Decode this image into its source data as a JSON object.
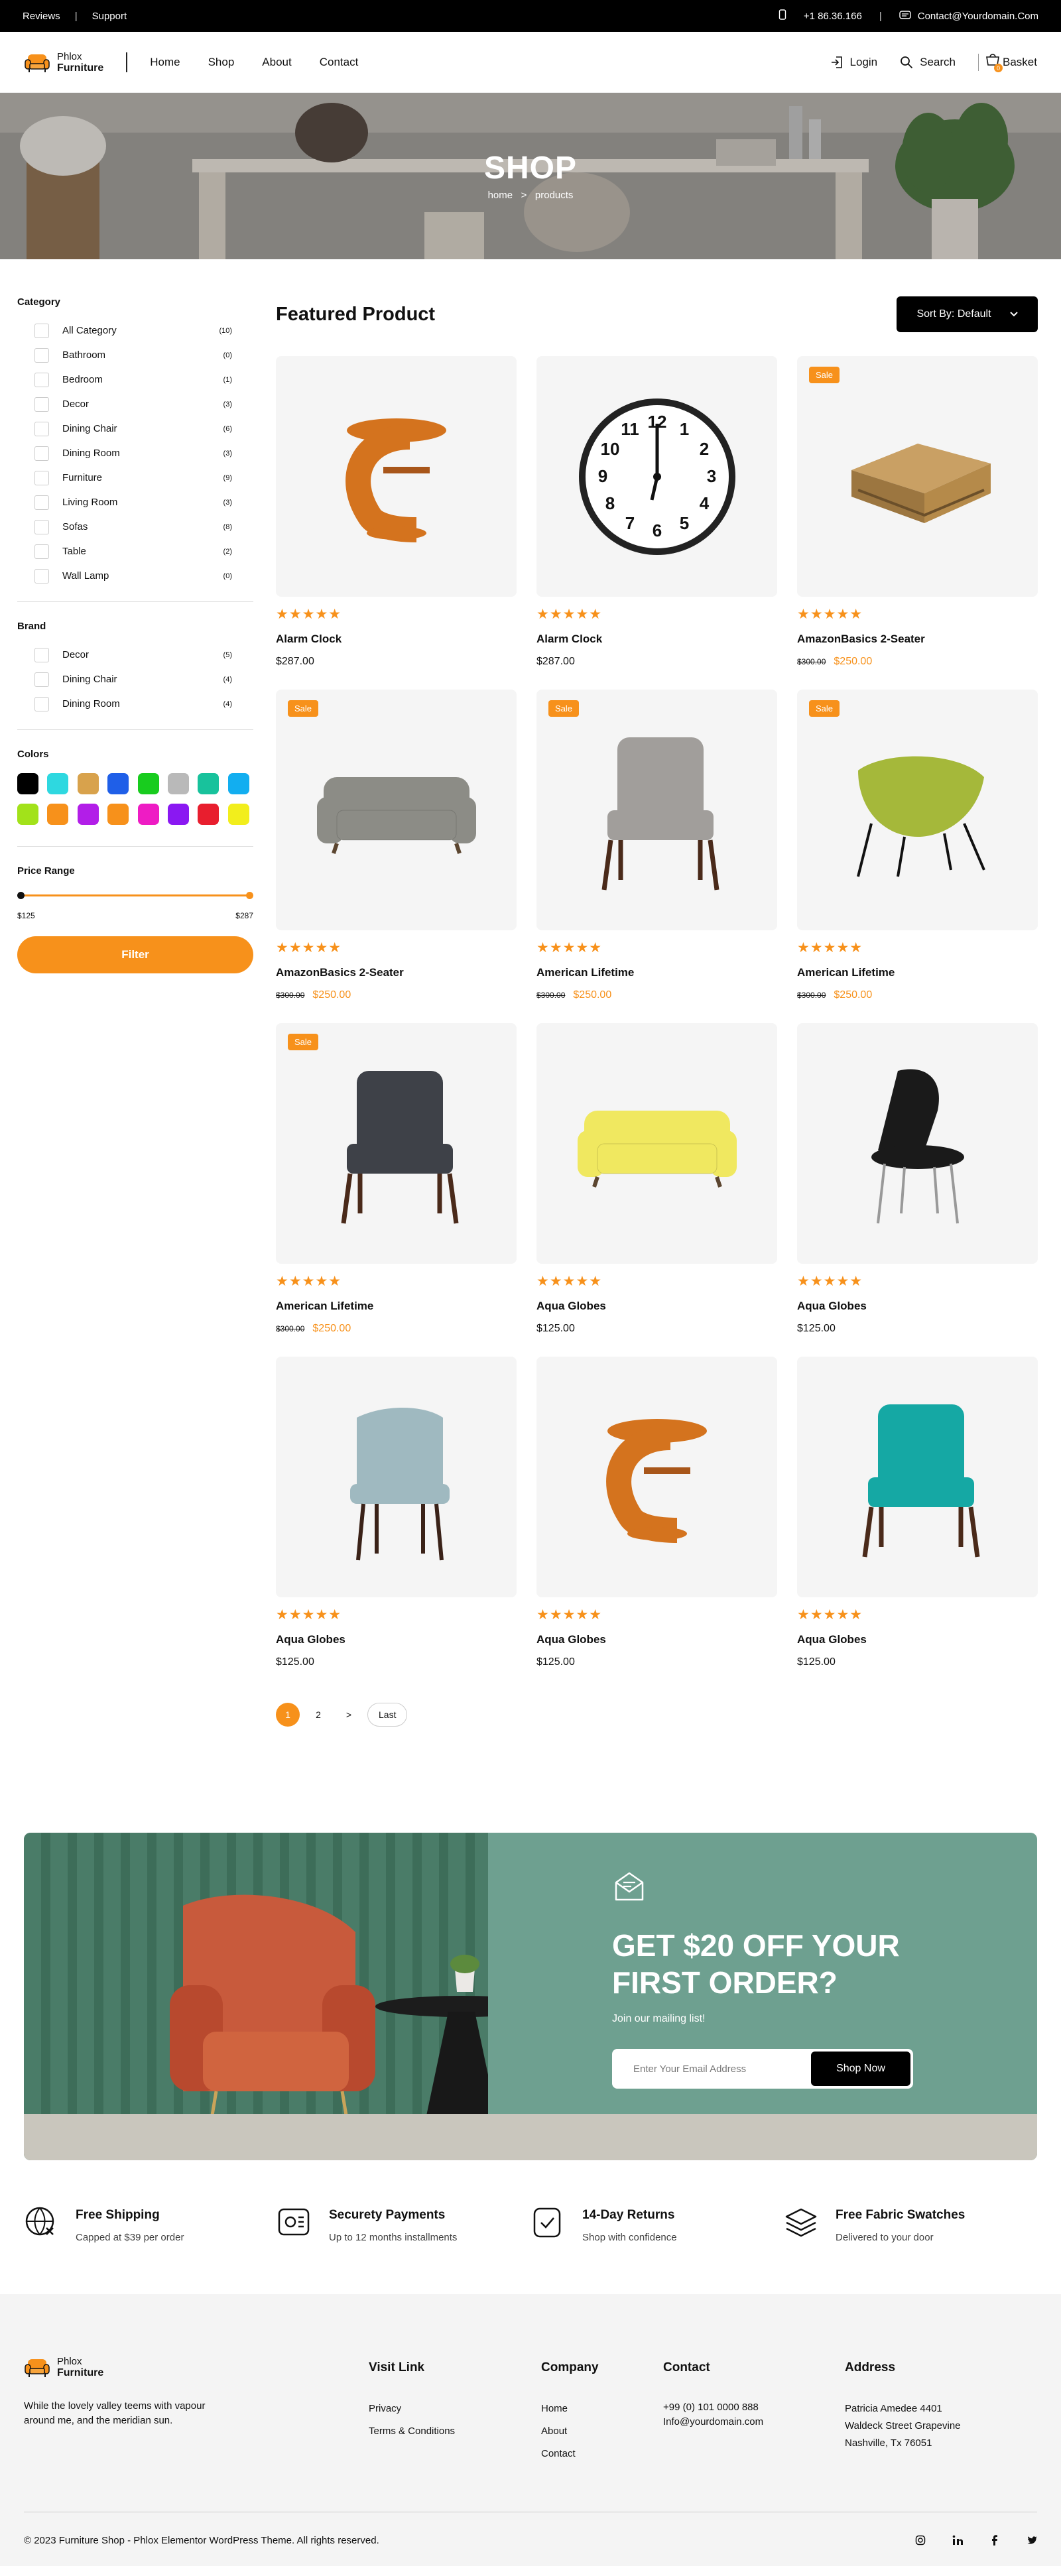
{
  "topbar": {
    "reviews": "Reviews",
    "support": "Support",
    "phone": "+1 86.36.166",
    "email": "Contact@Yourdomain.Com"
  },
  "brand": {
    "line1": "Phlox",
    "line2": "Furniture"
  },
  "nav": [
    "Home",
    "Shop",
    "About",
    "Contact"
  ],
  "header": {
    "login": "Login",
    "search": "Search",
    "basket": "Basket",
    "basket_count": "0"
  },
  "hero": {
    "title": "SHOP",
    "crumb_home": "home",
    "crumb_sep": ">",
    "crumb_current": "products"
  },
  "sidebar": {
    "category_title": "Category",
    "categories": [
      {
        "label": "All Category",
        "count": "(10)"
      },
      {
        "label": "Bathroom",
        "count": "(0)"
      },
      {
        "label": "Bedroom",
        "count": "(1)"
      },
      {
        "label": "Decor",
        "count": "(3)"
      },
      {
        "label": "Dining Chair",
        "count": "(6)"
      },
      {
        "label": "Dining Room",
        "count": "(3)"
      },
      {
        "label": "Furniture",
        "count": "(9)"
      },
      {
        "label": "Living Room",
        "count": "(3)"
      },
      {
        "label": "Sofas",
        "count": "(8)"
      },
      {
        "label": "Table",
        "count": "(2)"
      },
      {
        "label": "Wall Lamp",
        "count": "(0)"
      }
    ],
    "brand_title": "Brand",
    "brands": [
      {
        "label": "Decor",
        "count": "(5)"
      },
      {
        "label": "Dining Chair",
        "count": "(4)"
      },
      {
        "label": "Dining Room",
        "count": "(4)"
      }
    ],
    "colors_title": "Colors",
    "colors": [
      "#000000",
      "#2ed8e0",
      "#d8a24c",
      "#1f5fe8",
      "#18cc1e",
      "#b9b9b9",
      "#18c29c",
      "#12aef0",
      "#a2e21a",
      "#f7911b",
      "#b21ee8",
      "#f7911b",
      "#ee1cc4",
      "#8a18f2",
      "#e81e2e",
      "#f2ee1c"
    ],
    "price_title": "Price Range",
    "price_min": "$125",
    "price_max": "$287",
    "filter_label": "Filter"
  },
  "products_section": {
    "title": "Featured Product",
    "sort_label": "Sort By: Default"
  },
  "products": [
    {
      "name": "Alarm Clock",
      "stars": "★★★★★",
      "sale": "",
      "old_price": "",
      "price": "$287.00",
      "icon": "side-table-icon",
      "color": "#d4731e"
    },
    {
      "name": "Alarm Clock",
      "stars": "★★★★★",
      "sale": "",
      "old_price": "",
      "price": "$287.00",
      "icon": "wall-clock-icon",
      "color": "#111111"
    },
    {
      "name": "AmazonBasics 2-Seater",
      "stars": "★★★★★",
      "sale": "Sale",
      "old_price": "$300.00",
      "price": "$250.00",
      "icon": "pallet-table-icon",
      "color": "#b58a4a"
    },
    {
      "name": "AmazonBasics 2-Seater",
      "stars": "★★★★★",
      "sale": "Sale",
      "old_price": "$300.00",
      "price": "$250.00",
      "icon": "sofa-icon",
      "color": "#8c8c86"
    },
    {
      "name": "American Lifetime",
      "stars": "★★★★★",
      "sale": "Sale",
      "old_price": "$300.00",
      "price": "$250.00",
      "icon": "armchair-icon",
      "color": "#a19e9b"
    },
    {
      "name": "American Lifetime",
      "stars": "★★★★★",
      "sale": "Sale",
      "old_price": "$300.00",
      "price": "$250.00",
      "icon": "lounge-chair-icon",
      "color": "#a5b83a"
    },
    {
      "name": "American Lifetime",
      "stars": "★★★★★",
      "sale": "Sale",
      "old_price": "$300.00",
      "price": "$250.00",
      "icon": "armchair-icon",
      "color": "#3e4148"
    },
    {
      "name": "Aqua Globes",
      "stars": "★★★★★",
      "sale": "",
      "old_price": "",
      "price": "$125.00",
      "icon": "sofa-icon",
      "color": "#f0e860"
    },
    {
      "name": "Aqua Globes",
      "stars": "★★★★★",
      "sale": "",
      "old_price": "",
      "price": "$125.00",
      "icon": "chair-icon",
      "color": "#1a1a1a"
    },
    {
      "name": "Aqua Globes",
      "stars": "★★★★★",
      "sale": "",
      "old_price": "",
      "price": "$125.00",
      "icon": "dining-chair-icon",
      "color": "#9fb9c0"
    },
    {
      "name": "Aqua Globes",
      "stars": "★★★★★",
      "sale": "",
      "old_price": "",
      "price": "$125.00",
      "icon": "side-table-icon",
      "color": "#d4731e"
    },
    {
      "name": "Aqua Globes",
      "stars": "★★★★★",
      "sale": "",
      "old_price": "",
      "price": "$125.00",
      "icon": "armchair-icon",
      "color": "#15a8a4"
    }
  ],
  "pagination": {
    "p1": "1",
    "p2": "2",
    "next": ">",
    "last": "Last"
  },
  "promo": {
    "title": "GET $20 OFF YOUR FIRST ORDER?",
    "subtitle": "Join our mailing list!",
    "placeholder": "Enter Your Email Address",
    "button": "Shop Now"
  },
  "features": [
    {
      "title": "Free Shipping",
      "desc": "Capped at $39 per order",
      "icon": "globe-icon"
    },
    {
      "title": "Securety Payments",
      "desc": "Up to 12 months installments",
      "icon": "payment-icon"
    },
    {
      "title": "14-Day Returns",
      "desc": "Shop with confidence",
      "icon": "returns-icon"
    },
    {
      "title": "Free Fabric Swatches",
      "desc": "Delivered to your door",
      "icon": "layers-icon"
    }
  ],
  "footer": {
    "about": "While the lovely valley teems with vapour around me, and the meridian sun.",
    "visit_title": "Visit Link",
    "visit_links": [
      "Privacy",
      "Terms & Conditions"
    ],
    "company_title": "Company",
    "company_links": [
      "Home",
      "About",
      "Contact"
    ],
    "contact_title": "Contact",
    "phone": "+99 (0) 101 0000 888",
    "email": "Info@yourdomain.com",
    "address_title": "Address",
    "address": [
      "Patricia Amedee 4401",
      "Waldeck Street Grapevine",
      "Nashville, Tx 76051"
    ],
    "copyright": "© 2023 Furniture Shop - Phlox Elementor WordPress Theme. All rights reserved.",
    "social": [
      "instagram-icon",
      "linkedin-icon",
      "facebook-icon",
      "twitter-icon"
    ]
  }
}
